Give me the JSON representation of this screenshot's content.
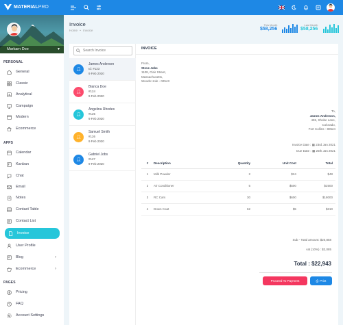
{
  "brand": {
    "name_main": "MATERIAL",
    "name_suffix": "PRO"
  },
  "user": {
    "name": "Markarn Doe"
  },
  "sidebar": {
    "sections": [
      "PERSONAL",
      "APPS",
      "PAGES"
    ],
    "items": [
      {
        "label": "General",
        "icon": "home-icon"
      },
      {
        "label": "Classic",
        "icon": "grid-icon"
      },
      {
        "label": "Analytical",
        "icon": "chart-icon"
      },
      {
        "label": "Campaign",
        "icon": "presentation-icon"
      },
      {
        "label": "Modern",
        "icon": "window-icon"
      },
      {
        "label": "Ecommerce",
        "icon": "shopping-bag-icon"
      },
      {
        "label": "Calendar",
        "icon": "calendar-icon"
      },
      {
        "label": "Kanban",
        "icon": "kanban-icon"
      },
      {
        "label": "Chat",
        "icon": "chat-icon"
      },
      {
        "label": "Email",
        "icon": "mail-icon"
      },
      {
        "label": "Notes",
        "icon": "note-icon"
      },
      {
        "label": "Contact Table",
        "icon": "table-icon"
      },
      {
        "label": "Contact List",
        "icon": "list-icon"
      },
      {
        "label": "Invoice",
        "icon": "file-icon"
      },
      {
        "label": "User Profile",
        "icon": "user-icon"
      },
      {
        "label": "Blog",
        "icon": "blog-icon"
      },
      {
        "label": "Ecommerce",
        "icon": "basket-icon"
      },
      {
        "label": "Pricing",
        "icon": "dollar-icon"
      },
      {
        "label": "FAQ",
        "icon": "help-icon"
      },
      {
        "label": "Account Settings",
        "icon": "settings-icon"
      }
    ]
  },
  "page": {
    "title": "Invoice",
    "breadcrumb_home": "Home",
    "breadcrumb_sep": "•",
    "breadcrumb_current": "Invoice"
  },
  "stats": {
    "this_month": {
      "label": "This Month",
      "value": "$58,256"
    },
    "last_month": {
      "label": "Last Month",
      "value": "$58,256"
    },
    "colors": {
      "this_month": "#1e88e5",
      "last_month": "#26c6da"
    }
  },
  "search": {
    "placeholder": "Search Invoice"
  },
  "invoices": [
    {
      "name": "James Anderson",
      "id": "Id: #123",
      "date": "9 Feb 2020",
      "color": "#1e88e5"
    },
    {
      "name": "Bianca Doe",
      "id": "#124",
      "date": "9 Feb 2020",
      "color": "#fc4b6c"
    },
    {
      "name": "Angelina Rhodes",
      "id": "#125",
      "date": "9 Feb 2020",
      "color": "#26c6da"
    },
    {
      "name": "Samuel Smith",
      "id": "#126",
      "date": "9 Feb 2020",
      "color": "#ffb22b"
    },
    {
      "name": "Gabriel Jobs",
      "id": "#127",
      "date": "9 Feb 2020",
      "color": "#1e88e5"
    }
  ],
  "detail": {
    "header": "INVOICE",
    "from_label": "From,",
    "from_name": "Steve Jobs",
    "from_addr1": "1108, Clair Street,",
    "from_addr2": "Massachusetts,",
    "from_addr3": "Woods Hole - 02543",
    "to_label": "To,",
    "to_name": "James Anderson,",
    "to_addr1": "455, Shobe Lane,",
    "to_addr2": "Colorado,",
    "to_addr3": "Fort Collins - 80524",
    "invoice_date_label": "Invoice Date :",
    "invoice_date": "23rd Jan 2021",
    "due_date_label": "Due Date :",
    "due_date": "25th Jan 2021",
    "columns": [
      "#",
      "Description",
      "Quantity",
      "Unit Cost",
      "Total"
    ],
    "rows": [
      {
        "n": "1",
        "desc": "Milk Powder",
        "qty": "2",
        "unit": "$24",
        "total": "$48"
      },
      {
        "n": "2",
        "desc": "Air Conditioner",
        "qty": "5",
        "unit": "$500",
        "total": "$2500"
      },
      {
        "n": "3",
        "desc": "RC Cars",
        "qty": "30",
        "unit": "$600",
        "total": "$18000"
      },
      {
        "n": "4",
        "desc": "Down Coat",
        "qty": "62",
        "unit": "$5",
        "total": "$310"
      }
    ],
    "subtotal_text": "Sub - Total amount: $20,858",
    "vat_text": "vat (10%) : $2,085",
    "total_text": "Total : $22,943",
    "proceed_label": "Proceed To Payment",
    "print_label": "Print"
  }
}
